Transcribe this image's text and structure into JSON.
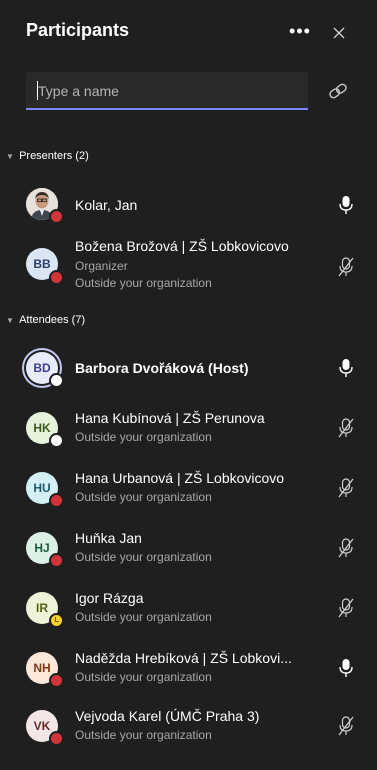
{
  "header": {
    "title": "Participants",
    "more_label": "•••"
  },
  "search": {
    "placeholder": "Type a name"
  },
  "sections": {
    "presenters": "Presenters (2)",
    "attendees": "Attendees (7)"
  },
  "presenters": [
    {
      "name": "Kolar, Jan",
      "initials": "",
      "mic": "on",
      "status": "red"
    },
    {
      "name": "Božena Brožová | ZŠ Lobkovicovo",
      "initials": "BB",
      "role": "Organizer",
      "sub": "Outside your organization",
      "mic": "muted",
      "status": "red"
    }
  ],
  "attendees": [
    {
      "name": "Barbora Dvořáková (Host)",
      "initials": "BD",
      "mic": "on",
      "status": "white"
    },
    {
      "name": "Hana Kubínová | ZŠ Perunova",
      "initials": "HK",
      "sub": "Outside your organization",
      "mic": "muted",
      "status": "white"
    },
    {
      "name": "Hana Urbanová | ZŠ Lobkovicovo",
      "initials": "HU",
      "sub": "Outside your organization",
      "mic": "muted",
      "status": "red"
    },
    {
      "name": "Huňka Jan",
      "initials": "HJ",
      "sub": "Outside your organization",
      "mic": "muted",
      "status": "red"
    },
    {
      "name": "Igor Rázga",
      "initials": "IR",
      "sub": "Outside your organization",
      "mic": "muted",
      "status": "yellow"
    },
    {
      "name": "Naděžda Hrebíková | ZŠ Lobkovi...",
      "initials": "NH",
      "sub": "Outside your organization",
      "mic": "on",
      "status": "red"
    },
    {
      "name": "Vejvoda Karel (ÚMČ Praha 3)",
      "initials": "VK",
      "sub": "Outside your organization",
      "mic": "muted",
      "status": "red"
    }
  ],
  "colors": {
    "background": "#1f1f1f",
    "accent": "#7f85f5",
    "status_red": "#d13438",
    "avatar_bb": "#dbe6f4",
    "avatar_bd": "#e8ebfa",
    "avatar_hk": "#e7f2da",
    "avatar_hu": "#d5f0f5",
    "avatar_hj": "#dbf1e5",
    "avatar_ir": "#eef2d6",
    "avatar_nh": "#fde7d9",
    "avatar_vk": "#f3e6e6"
  }
}
